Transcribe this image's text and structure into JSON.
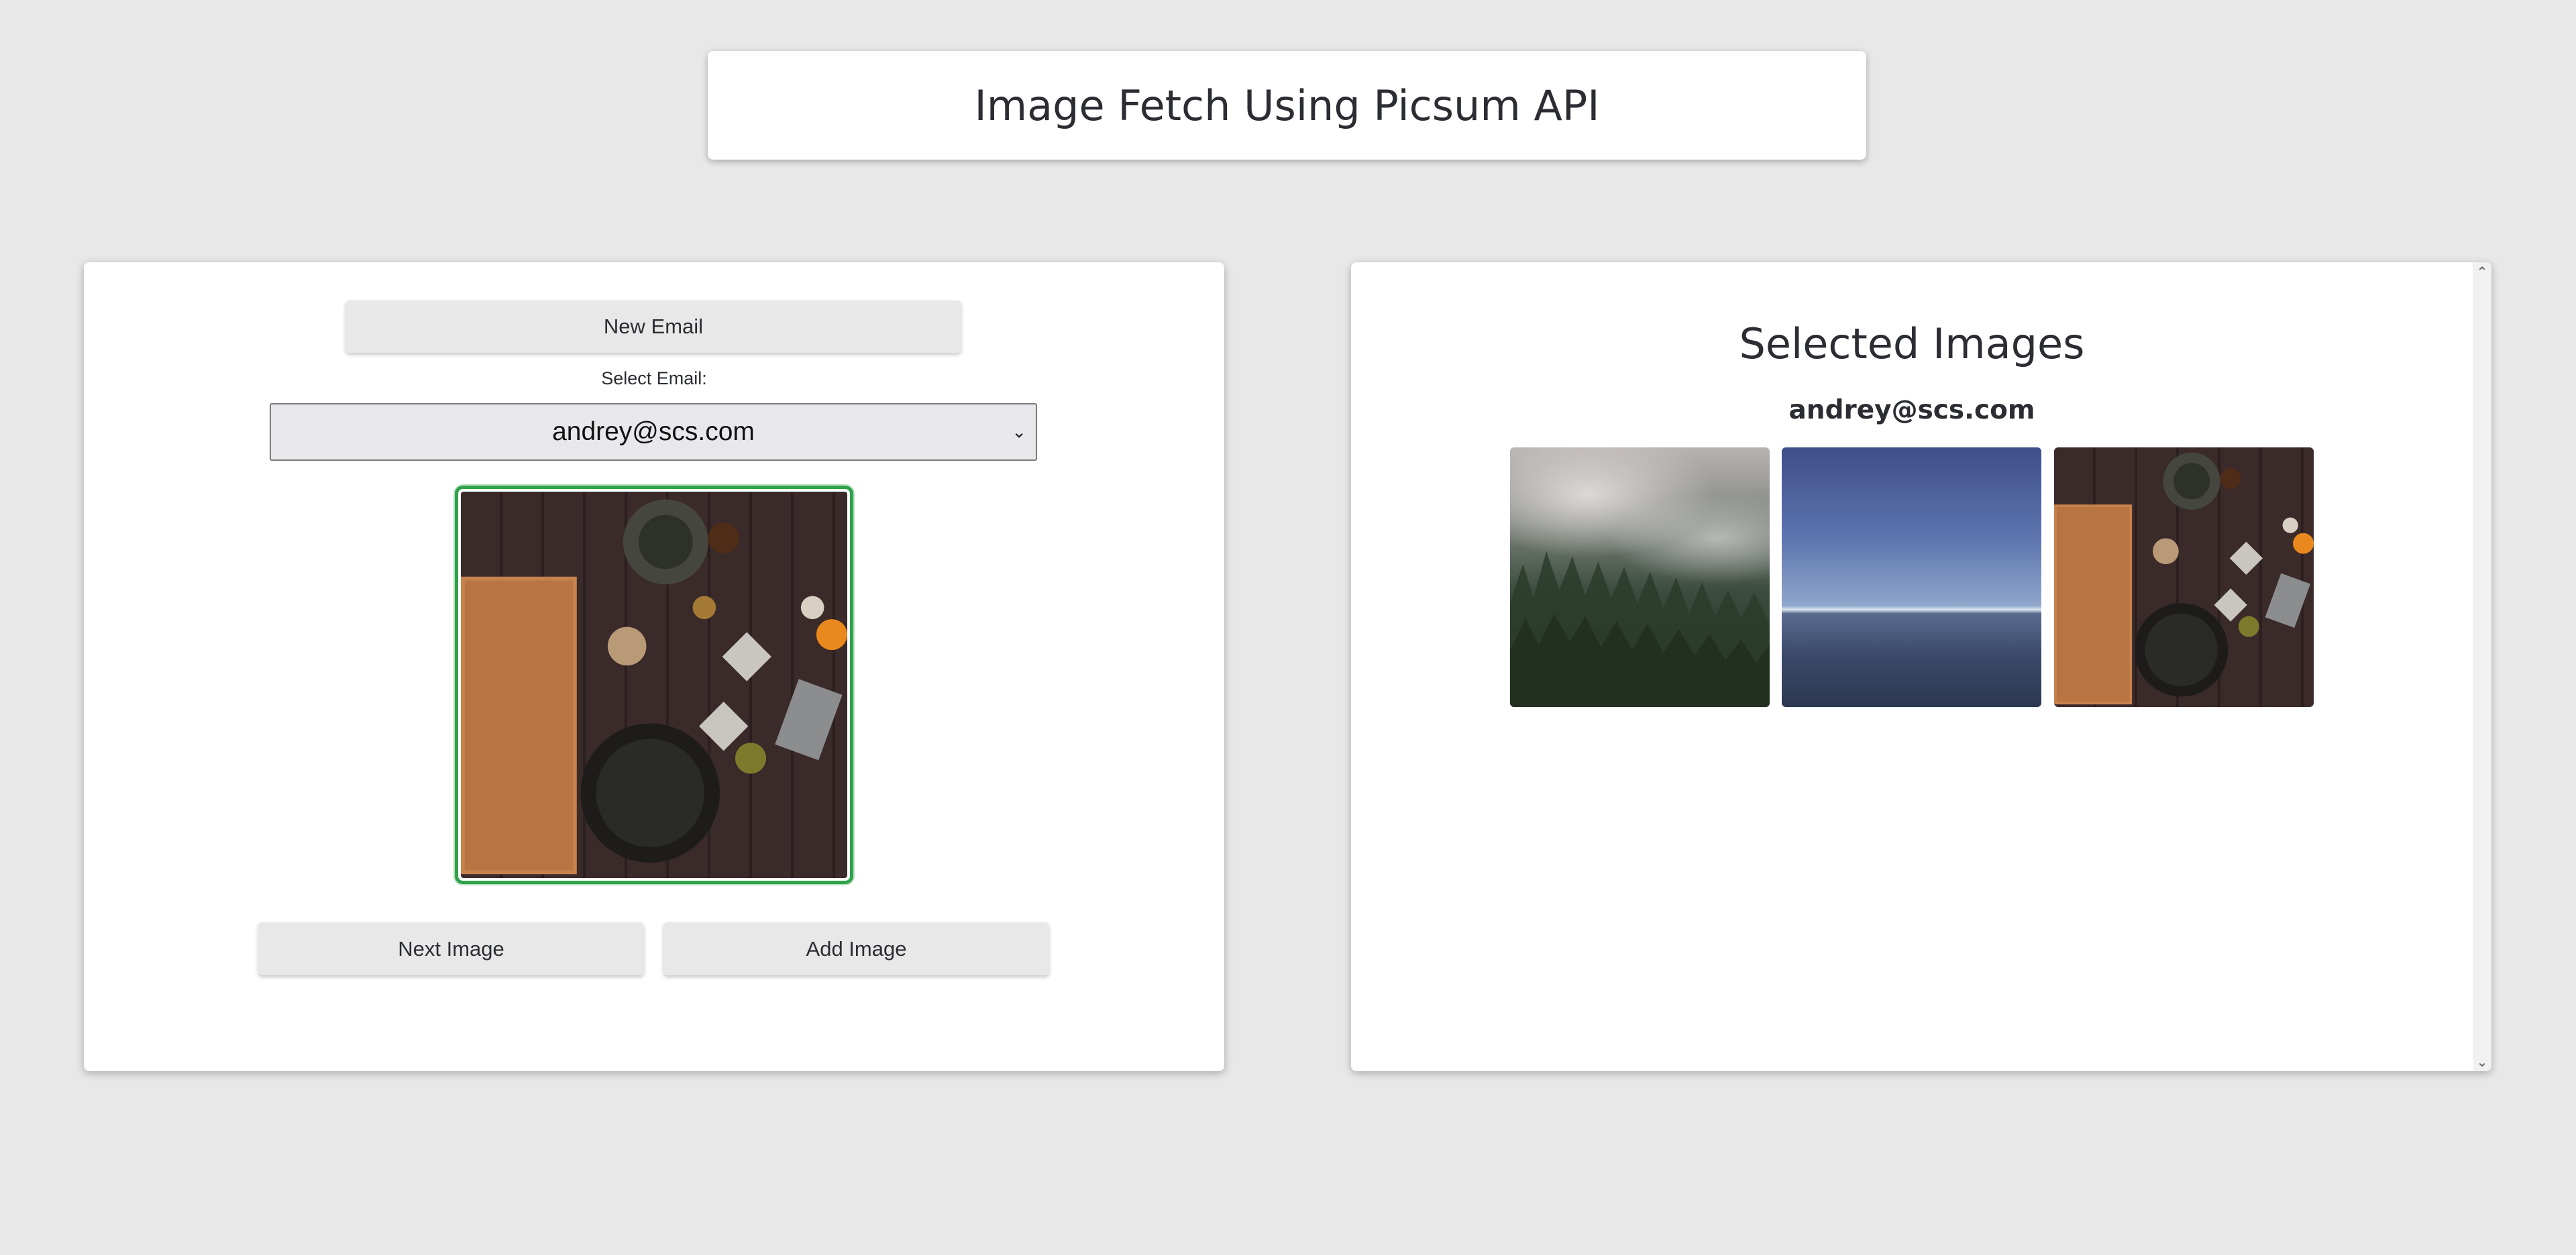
{
  "header": {
    "title": "Image Fetch Using Picsum API"
  },
  "left_panel": {
    "new_email_label": "New Email",
    "select_label": "Select Email:",
    "selected_email": "andrey@scs.com",
    "next_image_label": "Next Image",
    "add_image_label": "Add Image"
  },
  "right_panel": {
    "title": "Selected Images",
    "email": "andrey@scs.com"
  },
  "colors": {
    "preview_border": "#2fa24a",
    "background": "#e8e8e8"
  }
}
